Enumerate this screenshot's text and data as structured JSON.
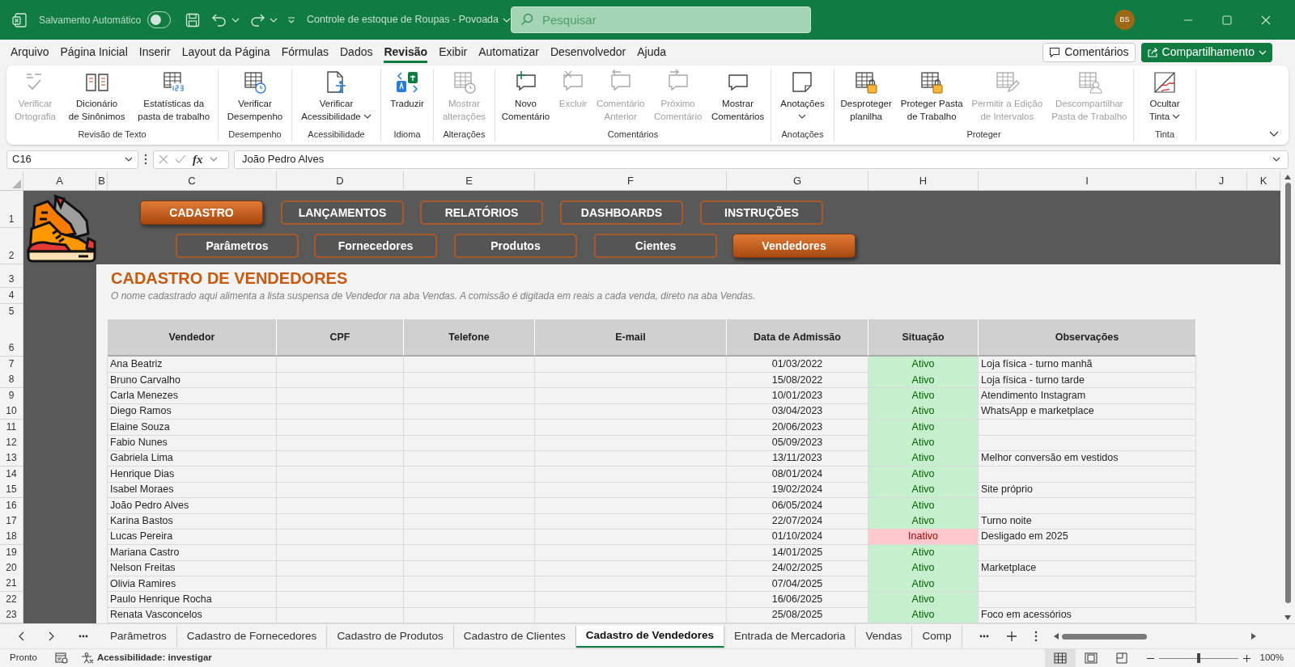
{
  "title_bar": {
    "autosave_label": "Salvamento Automático",
    "autosave_on": false,
    "document_title": "Controle de estoque de Roupas - Povoada",
    "search_placeholder": "Pesquisar",
    "avatar_initials": "BS"
  },
  "menu_tabs": [
    {
      "label": "Arquivo",
      "selected": false
    },
    {
      "label": "Página Inicial",
      "selected": false
    },
    {
      "label": "Inserir",
      "selected": false
    },
    {
      "label": "Layout da Página",
      "selected": false
    },
    {
      "label": "Fórmulas",
      "selected": false
    },
    {
      "label": "Dados",
      "selected": false
    },
    {
      "label": "Revisão",
      "selected": true
    },
    {
      "label": "Exibir",
      "selected": false
    },
    {
      "label": "Automatizar",
      "selected": false
    },
    {
      "label": "Desenvolvedor",
      "selected": false
    },
    {
      "label": "Ajuda",
      "selected": false
    }
  ],
  "top_right_buttons": {
    "comments": "Comentários",
    "share": "Compartilhamento"
  },
  "ribbon_groups": [
    {
      "label": "Revisão de Texto",
      "buttons": [
        {
          "lines": [
            "Verificar",
            "Ortografia"
          ],
          "disabled": true,
          "dropdown": false
        },
        {
          "lines": [
            "Dicionário",
            "de Sinônimos"
          ],
          "disabled": false,
          "dropdown": false
        },
        {
          "lines": [
            "Estatísticas da",
            "pasta de trabalho"
          ],
          "disabled": false,
          "dropdown": false
        }
      ]
    },
    {
      "label": "Desempenho",
      "buttons": [
        {
          "lines": [
            "Verificar",
            "Desempenho"
          ],
          "disabled": false,
          "dropdown": false
        }
      ]
    },
    {
      "label": "Acessibilidade",
      "buttons": [
        {
          "lines": [
            "Verificar",
            "Acessibilidade"
          ],
          "disabled": false,
          "dropdown": true
        }
      ]
    },
    {
      "label": "Idioma",
      "buttons": [
        {
          "lines": [
            "Traduzir"
          ],
          "disabled": false,
          "dropdown": false
        }
      ]
    },
    {
      "label": "Alterações",
      "buttons": [
        {
          "lines": [
            "Mostrar",
            "alterações"
          ],
          "disabled": true,
          "dropdown": false
        }
      ]
    },
    {
      "label": "Comentários",
      "buttons": [
        {
          "lines": [
            "Novo",
            "Comentário"
          ],
          "disabled": false,
          "dropdown": false
        },
        {
          "lines": [
            "Excluir"
          ],
          "disabled": true,
          "dropdown": false
        },
        {
          "lines": [
            "Comentário",
            "Anterior"
          ],
          "disabled": true,
          "dropdown": false
        },
        {
          "lines": [
            "Próximo",
            "Comentário"
          ],
          "disabled": true,
          "dropdown": false
        },
        {
          "lines": [
            "Mostrar",
            "Comentários"
          ],
          "disabled": false,
          "dropdown": false
        }
      ]
    },
    {
      "label": "Anotações",
      "buttons": [
        {
          "lines": [
            "Anotações"
          ],
          "disabled": false,
          "dropdown": true
        }
      ]
    },
    {
      "label": "Proteger",
      "buttons": [
        {
          "lines": [
            "Desproteger",
            "planilha"
          ],
          "disabled": false,
          "dropdown": false
        },
        {
          "lines": [
            "Proteger Pasta",
            "de Trabalho"
          ],
          "disabled": false,
          "dropdown": false
        },
        {
          "lines": [
            "Permitir a Edição",
            "de Intervalos"
          ],
          "disabled": true,
          "dropdown": false
        },
        {
          "lines": [
            "Descompartilhar",
            "Pasta de Trabalho"
          ],
          "disabled": true,
          "dropdown": false
        }
      ]
    },
    {
      "label": "Tinta",
      "buttons": [
        {
          "lines": [
            "Ocultar",
            "Tinta"
          ],
          "disabled": false,
          "dropdown": true
        }
      ]
    }
  ],
  "formula_bar": {
    "name_box": "C16",
    "function_label": "fx",
    "value": "João Pedro Alves"
  },
  "column_headers": [
    "A",
    "B",
    "C",
    "D",
    "E",
    "F",
    "G",
    "H",
    "I",
    "J",
    "K"
  ],
  "row_headers": [
    "1",
    "2",
    "3",
    "4",
    "5",
    "6",
    "7",
    "8",
    "9",
    "10",
    "11",
    "12",
    "13",
    "14",
    "15",
    "16",
    "17",
    "18",
    "19",
    "20",
    "21",
    "22",
    "23"
  ],
  "nav_buttons": {
    "primary": [
      {
        "label": "CADASTRO",
        "selected": true
      },
      {
        "label": "LANÇAMENTOS",
        "selected": false
      },
      {
        "label": "RELATÓRIOS",
        "selected": false
      },
      {
        "label": "DASHBOARDS",
        "selected": false
      },
      {
        "label": "INSTRUÇÕES",
        "selected": false
      }
    ],
    "secondary": [
      {
        "label": "Parâmetros",
        "selected": false
      },
      {
        "label": "Fornecedores",
        "selected": false
      },
      {
        "label": "Produtos",
        "selected": false
      },
      {
        "label": "Cientes",
        "selected": false
      },
      {
        "label": "Vendedores",
        "selected": true
      }
    ]
  },
  "sheet_title": "CADASTRO DE VENDEDORES",
  "sheet_subtitle": "O nome cadastrado aqui alimenta a lista suspensa de Vendedor na aba Vendas. A comissão é digitada em reais a cada venda, direto na aba Vendas.",
  "table": {
    "columns": [
      "Vendedor",
      "CPF",
      "Telefone",
      "E-mail",
      "Data de Admissão",
      "Situação",
      "Observações"
    ],
    "rows": [
      {
        "name": "Ana Beatriz",
        "admission_date": "01/03/2022",
        "status": "Ativo",
        "kind": "active",
        "notes": "Loja física - turno manhã"
      },
      {
        "name": "Bruno Carvalho",
        "admission_date": "15/08/2022",
        "status": "Ativo",
        "kind": "active",
        "notes": "Loja física - turno tarde"
      },
      {
        "name": "Carla Menezes",
        "admission_date": "10/01/2023",
        "status": "Ativo",
        "kind": "active",
        "notes": "Atendimento Instagram"
      },
      {
        "name": "Diego Ramos",
        "admission_date": "03/04/2023",
        "status": "Ativo",
        "kind": "active",
        "notes": "WhatsApp e marketplace"
      },
      {
        "name": "Elaine Souza",
        "admission_date": "20/06/2023",
        "status": "Ativo",
        "kind": "active"
      },
      {
        "name": "Fabio Nunes",
        "admission_date": "05/09/2023",
        "status": "Ativo",
        "kind": "active"
      },
      {
        "name": "Gabriela Lima",
        "admission_date": "13/11/2023",
        "status": "Ativo",
        "kind": "active",
        "notes": "Melhor conversão em vestidos"
      },
      {
        "name": "Henrique Dias",
        "admission_date": "08/01/2024",
        "status": "Ativo",
        "kind": "active"
      },
      {
        "name": "Isabel Moraes",
        "admission_date": "19/02/2024",
        "status": "Ativo",
        "kind": "active",
        "notes": "Site próprio"
      },
      {
        "name": "João Pedro Alves",
        "admission_date": "06/05/2024",
        "status": "Ativo",
        "kind": "active"
      },
      {
        "name": "Karina Bastos",
        "admission_date": "22/07/2024",
        "status": "Ativo",
        "kind": "active",
        "notes": "Turno noite"
      },
      {
        "name": "Lucas Pereira",
        "admission_date": "01/10/2024",
        "status": "Inativo",
        "kind": "inactive",
        "notes": "Desligado em 2025"
      },
      {
        "name": "Mariana Castro",
        "admission_date": "14/01/2025",
        "status": "Ativo",
        "kind": "active"
      },
      {
        "name": "Nelson Freitas",
        "admission_date": "24/02/2025",
        "status": "Ativo",
        "kind": "active",
        "notes": "Marketplace"
      },
      {
        "name": "Olivia Ramires",
        "admission_date": "07/04/2025",
        "status": "Ativo",
        "kind": "active"
      },
      {
        "name": "Paulo Henrique Rocha",
        "admission_date": "16/06/2025",
        "status": "Ativo",
        "kind": "active"
      },
      {
        "name": "Renata Vasconcelos",
        "admission_date": "25/08/2025",
        "status": "Ativo",
        "kind": "active",
        "notes": "Foco em acessórios"
      }
    ]
  },
  "sheet_tabs": [
    {
      "label": "Parâmetros",
      "selected": false
    },
    {
      "label": "Cadastro de Fornecedores",
      "selected": false
    },
    {
      "label": "Cadastro de Produtos",
      "selected": false
    },
    {
      "label": "Cadastro de Clientes",
      "selected": false
    },
    {
      "label": "Cadastro de Vendedores",
      "selected": true
    },
    {
      "label": "Entrada de Mercadoria",
      "selected": false
    },
    {
      "label": "Vendas",
      "selected": false
    },
    {
      "label": "Comp",
      "selected": false
    }
  ],
  "status_bar": {
    "status": "Pronto",
    "accessibility": "Acessibilidade: investigar",
    "views": [
      {
        "selected": true
      },
      {
        "selected": false
      },
      {
        "selected": false
      }
    ],
    "zoom_slider": {
      "level": 0.5
    },
    "zoom_label": "100%"
  }
}
